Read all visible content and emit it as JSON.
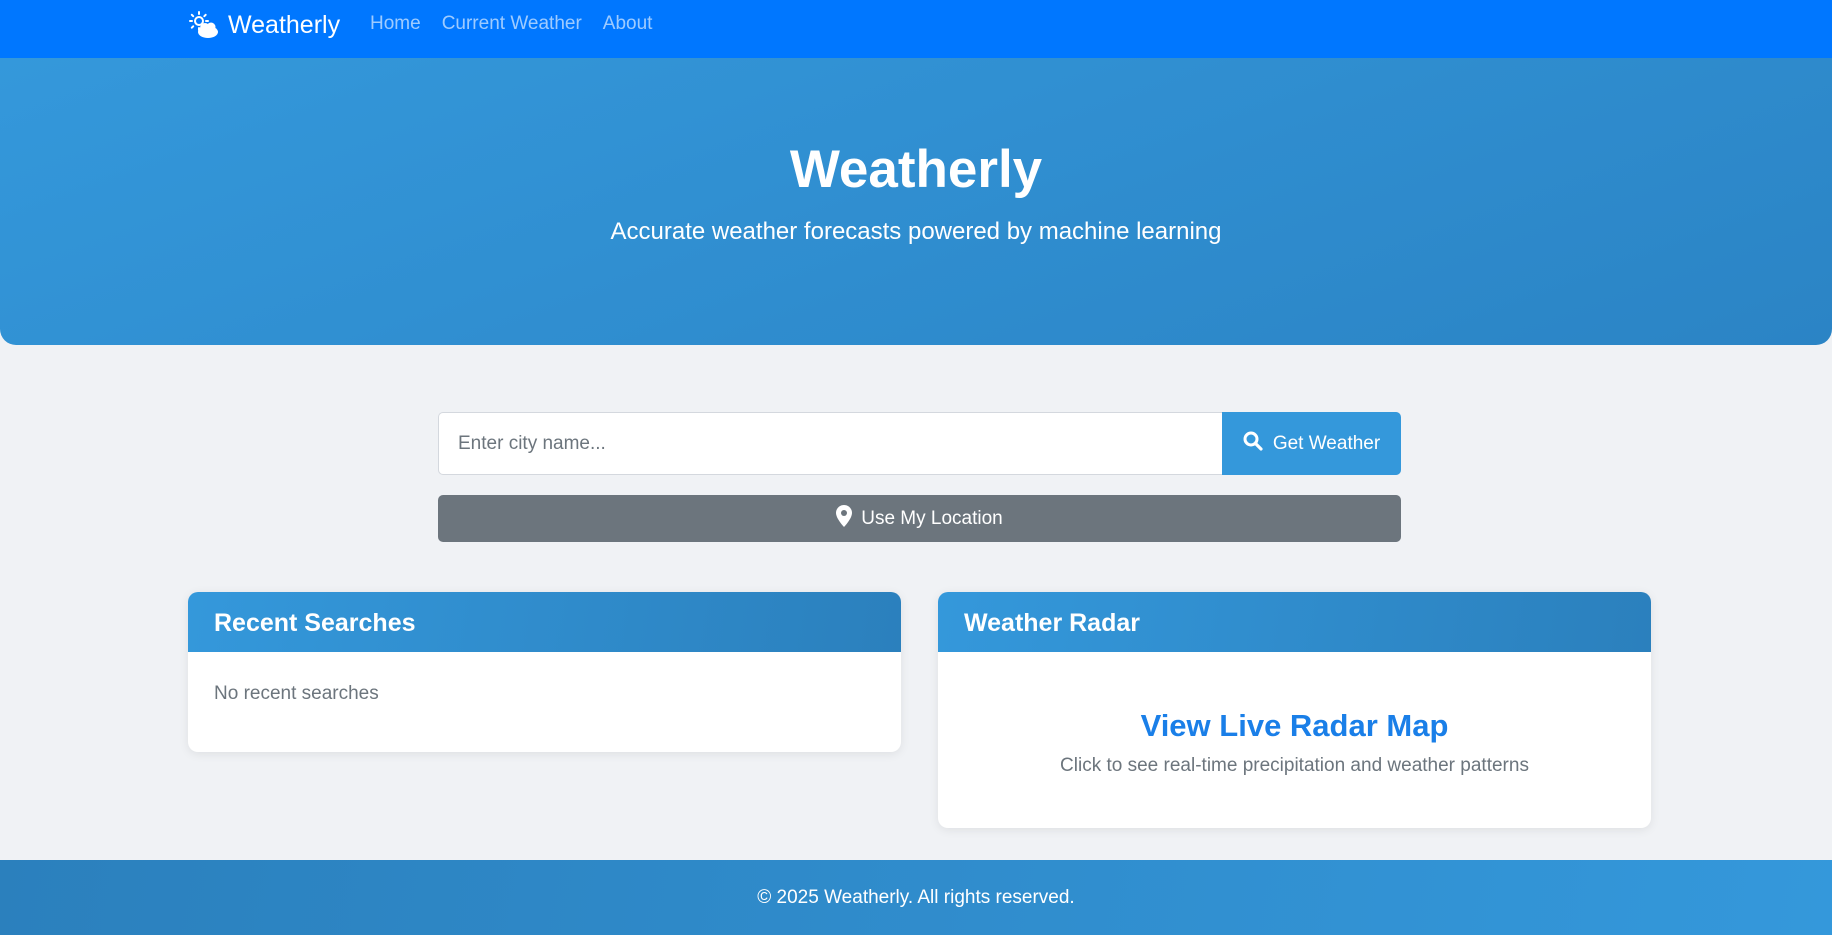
{
  "navbar": {
    "brand": "Weatherly",
    "brand_icon": "sun-cloud-icon",
    "links": [
      {
        "label": "Home"
      },
      {
        "label": "Current Weather"
      },
      {
        "label": "About"
      }
    ]
  },
  "hero": {
    "title": "Weatherly",
    "subtitle": "Accurate weather forecasts powered by machine learning"
  },
  "search": {
    "placeholder": "Enter city name...",
    "value": "",
    "button_label": "Get Weather",
    "button_icon": "search-icon"
  },
  "location": {
    "button_label": "Use My Location",
    "button_icon": "map-pin-icon"
  },
  "recent_searches": {
    "title": "Recent Searches",
    "empty_text": "No recent searches"
  },
  "radar": {
    "title": "Weather Radar",
    "link_label": "View Live Radar Map",
    "description": "Click to see real-time precipitation and weather patterns"
  },
  "footer": {
    "text": "© 2025 Weatherly. All rights reserved."
  },
  "colors": {
    "navbar": "#0077ff",
    "primary": "#3498db",
    "primary_dark": "#2b80bd",
    "secondary_button": "#6c757d",
    "link": "#1a7fe8",
    "page_background": "#f0f2f5"
  }
}
